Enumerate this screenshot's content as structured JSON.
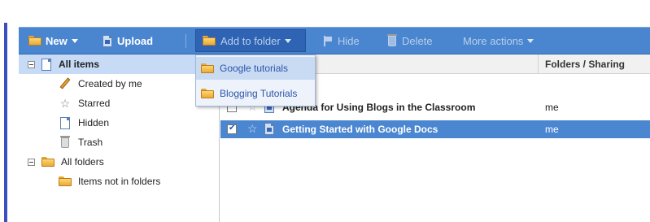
{
  "toolbar": {
    "new_label": "New",
    "upload_label": "Upload",
    "add_to_folder_label": "Add to folder",
    "hide_label": "Hide",
    "delete_label": "Delete",
    "more_actions_label": "More actions",
    "accent_color": "#4a86cf"
  },
  "add_to_folder_menu": {
    "items": [
      {
        "label": "Google tutorials",
        "icon": "folder-icon"
      },
      {
        "label": "Blogging Tutorials",
        "icon": "folder-icon"
      }
    ]
  },
  "sidebar": {
    "all_items": {
      "label": "All items",
      "icon": "document-icon",
      "selected": true
    },
    "items": [
      {
        "label": "Created by me",
        "icon": "pencil-icon"
      },
      {
        "label": "Starred",
        "icon": "star-icon"
      },
      {
        "label": "Hidden",
        "icon": "document-icon"
      },
      {
        "label": "Trash",
        "icon": "trash-icon"
      }
    ],
    "all_folders": {
      "label": "All folders",
      "icon": "folder-icon"
    },
    "folders": [
      {
        "label": "Items not in folders",
        "icon": "folder-icon"
      }
    ]
  },
  "list": {
    "columns": {
      "folders_sharing": "Folders / Sharing"
    },
    "rows": [
      {
        "title": "Agenda for Using Blogs in the Classroom",
        "owner": "me",
        "checked": false,
        "selected": false
      },
      {
        "title": "Getting Started with Google Docs",
        "owner": "me",
        "checked": true,
        "selected": true
      }
    ],
    "selected_row_color": "#4b86d0"
  }
}
